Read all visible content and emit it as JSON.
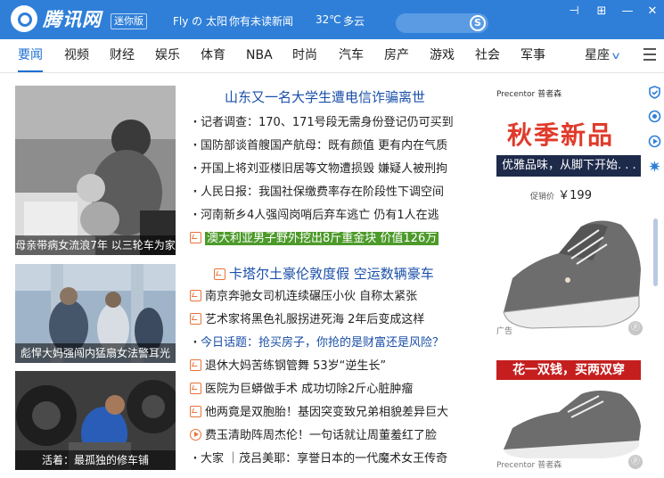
{
  "titlebar": {
    "logo_text": "腾讯网",
    "mini_badge": "迷你版",
    "user": "Fly の 太阳",
    "unread": "你有未读新闻",
    "temperature": "32℃",
    "weather": "多云",
    "search_icon_glyph": "S",
    "pin_glyph": "⊣",
    "maximize_glyph": "⊞",
    "minimize_glyph": "—",
    "close_glyph": "✕"
  },
  "nav": {
    "tabs": [
      "要闻",
      "视频",
      "财经",
      "娱乐",
      "体育",
      "NBA",
      "时尚",
      "汽车",
      "房产",
      "游戏",
      "社会",
      "军事"
    ],
    "more": "星座",
    "active_tab": "要闻"
  },
  "photos": [
    {
      "caption": "母亲带病女流浪7年 以三轮车为家"
    },
    {
      "caption": "彪悍大妈强闯内猛扇女法警耳光"
    },
    {
      "caption": "活着：最孤独的修车铺"
    }
  ],
  "headline": "山东又一名大学生遭电信诈骗离世",
  "news_block1": [
    {
      "icon": "bullet",
      "text": "记者调查：170、171号段无需身份登记仍可买到"
    },
    {
      "icon": "bullet",
      "text": "国防部谈首艘国产航母：既有颜值 更有内在气质"
    },
    {
      "icon": "bullet",
      "text": "开国上将刘亚楼旧居等文物遭损毁 嫌疑人被刑拘"
    },
    {
      "icon": "bullet",
      "text": "人民日报：我国社保缴费率存在阶段性下调空间"
    },
    {
      "icon": "bullet",
      "text": "河南新乡4人强闯岗哨后弃车逃亡 仍有1人在逃"
    },
    {
      "icon": "photo",
      "text": "澳大利亚男子野外挖出8斤重金块 价值126万",
      "highlight": true
    }
  ],
  "headline2": "卡塔尔土豪伦敦度假 空运数辆豪车",
  "news_block2": [
    {
      "icon": "photo",
      "text": "南京奔驰女司机连续碾压小伙 自称太紧张"
    },
    {
      "icon": "photo",
      "text": "艺术家将黑色礼服拐进死海 2年后变成这样"
    },
    {
      "icon": "bullet",
      "text": "今日话题：抢买房子，你抢的是财富还是风险？",
      "blue": true
    },
    {
      "icon": "photo",
      "text": "退休大妈苦练钢管舞 53岁“逆生长”"
    },
    {
      "icon": "photo",
      "text": "医院为巨蟒做手术 成功切除2斤心脏肿瘤"
    },
    {
      "icon": "photo",
      "text": "他两竟是双胞胎！基因突变致兄弟相貌差异巨大"
    },
    {
      "icon": "play",
      "text": "费玉清助阵周杰伦！一句话就让周董羞红了脸"
    },
    {
      "icon": "bullet",
      "text": "大家 ｜茂吕美耶：享誉日本的一代魔术女王传奇"
    }
  ],
  "ad": {
    "brand": "Precentor 普者森",
    "title": "秋季新品",
    "tagline": "优雅品味，从脚下开始. . . .",
    "price_label": "促销价",
    "price": "￥199",
    "slogan": "花一双钱，买两双穿",
    "ad_label": "广告",
    "brand2": "Precentor 普者森",
    "pin_glyph": "ⓟ"
  },
  "colors": {
    "titlebar": "#2f7fd8",
    "accent": "#1d6fd1",
    "highlight": "#4c9a2a",
    "ad_red": "#e03a2a"
  }
}
